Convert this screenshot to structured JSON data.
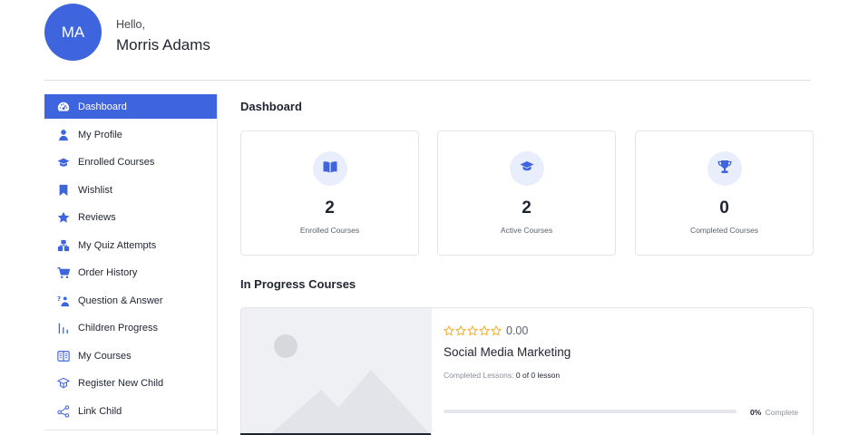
{
  "user": {
    "initials": "MA",
    "greeting": "Hello,",
    "name": "Morris Adams"
  },
  "sidebar": {
    "items": [
      {
        "label": "Dashboard",
        "icon": "dashboard-icon",
        "active": true
      },
      {
        "label": "My Profile",
        "icon": "user-icon"
      },
      {
        "label": "Enrolled Courses",
        "icon": "graduation-cap-icon"
      },
      {
        "label": "Wishlist",
        "icon": "bookmark-icon"
      },
      {
        "label": "Reviews",
        "icon": "star-icon"
      },
      {
        "label": "My Quiz Attempts",
        "icon": "quiz-icon"
      },
      {
        "label": "Order History",
        "icon": "cart-icon"
      },
      {
        "label": "Question & Answer",
        "icon": "question-answer-icon"
      },
      {
        "label": "Children Progress",
        "icon": "bar-chart-icon"
      },
      {
        "label": "My Courses",
        "icon": "courses-icon"
      },
      {
        "label": "Register New Child",
        "icon": "register-child-icon"
      },
      {
        "label": "Link Child",
        "icon": "share-link-icon"
      }
    ]
  },
  "main": {
    "title": "Dashboard",
    "stats": [
      {
        "value": "2",
        "label": "Enrolled Courses",
        "icon": "book-open-icon"
      },
      {
        "value": "2",
        "label": "Active Courses",
        "icon": "graduation-cap-icon"
      },
      {
        "value": "0",
        "label": "Completed Courses",
        "icon": "trophy-icon"
      }
    ],
    "in_progress_title": "In Progress Courses",
    "course": {
      "rating": "0.00",
      "stars": 0,
      "name": "Social Media Marketing",
      "lessons_label": "Completed Lessons:",
      "lessons_value": "0 of 0 lesson",
      "progress": 0,
      "progress_pct": "0%",
      "progress_word": "Complete"
    }
  },
  "colors": {
    "accent": "#3e64de",
    "star": "#f0ad2b",
    "icon_bg": "#e9eefc"
  }
}
